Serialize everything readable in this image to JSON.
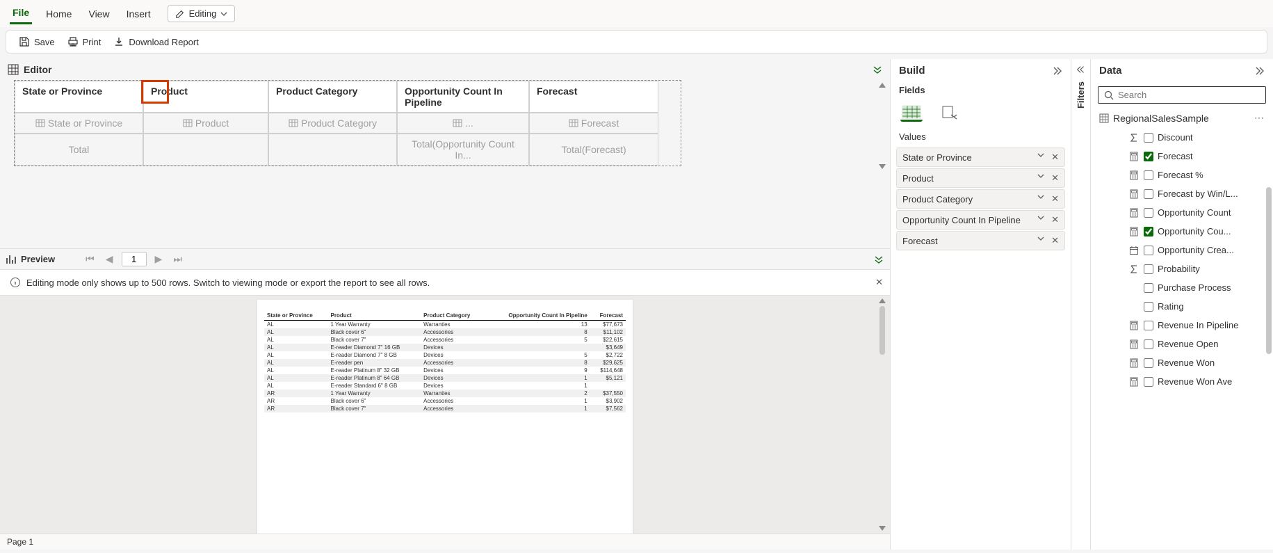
{
  "menu": {
    "file": "File",
    "home": "Home",
    "view": "View",
    "insert": "Insert",
    "editing": "Editing"
  },
  "toolbar": {
    "save": "Save",
    "print": "Print",
    "download": "Download Report"
  },
  "editor": {
    "title": "Editor",
    "headers": {
      "c1": "State or Province",
      "c2": "Product",
      "c3": "Product Category",
      "c4": "Opportunity Count In Pipeline",
      "c5": "Forecast"
    },
    "placeholders": {
      "c1": "State or Province",
      "c2": "Product",
      "c3": "Product Category",
      "c4": "...",
      "c5": "Forecast"
    },
    "totals": {
      "label": "Total",
      "c4": "Total(Opportunity Count In...",
      "c5": "Total(Forecast)"
    }
  },
  "preview": {
    "title": "Preview",
    "page": "1",
    "info": "Editing mode only shows up to 500 rows. Switch to viewing mode or export the report to see all rows.",
    "headers": [
      "State or Province",
      "Product",
      "Product Category",
      "Opportunity Count In Pipeline",
      "Forecast"
    ],
    "rows": [
      [
        "AL",
        "1 Year Warranty",
        "Warranties",
        "13",
        "$77,673"
      ],
      [
        "AL",
        "Black cover 6\"",
        "Accessories",
        "8",
        "$11,102"
      ],
      [
        "AL",
        "Black cover 7\"",
        "Accessories",
        "5",
        "$22,615"
      ],
      [
        "AL",
        "E-reader Diamond 7\" 16 GB",
        "Devices",
        "",
        "$3,649"
      ],
      [
        "AL",
        "E-reader Diamond 7\" 8 GB",
        "Devices",
        "5",
        "$2,722"
      ],
      [
        "AL",
        "E-reader pen",
        "Accessories",
        "8",
        "$29,625"
      ],
      [
        "AL",
        "E-reader Platinum 8\" 32 GB",
        "Devices",
        "9",
        "$114,648"
      ],
      [
        "AL",
        "E-reader Platinum 8\" 64 GB",
        "Devices",
        "1",
        "$5,121"
      ],
      [
        "AL",
        "E-reader Standard 6\" 8 GB",
        "Devices",
        "1",
        ""
      ],
      [
        "AR",
        "1 Year Warranty",
        "Warranties",
        "2",
        "$37,550"
      ],
      [
        "AR",
        "Black cover 6\"",
        "Accessories",
        "1",
        "$3,902"
      ],
      [
        "AR",
        "Black cover 7\"",
        "Accessories",
        "1",
        "$7,562"
      ]
    ]
  },
  "status": {
    "page": "Page 1"
  },
  "build": {
    "title": "Build",
    "fields": "Fields",
    "values": "Values",
    "pills": [
      "State or Province",
      "Product",
      "Product Category",
      "Opportunity Count In Pipeline",
      "Forecast"
    ]
  },
  "filters": {
    "label": "Filters"
  },
  "data": {
    "title": "Data",
    "search_ph": "Search",
    "dataset": "RegionalSalesSample",
    "fields": [
      {
        "icon": "sigma",
        "checked": false,
        "label": "Discount"
      },
      {
        "icon": "calc",
        "checked": true,
        "label": "Forecast"
      },
      {
        "icon": "calc",
        "checked": false,
        "label": "Forecast %"
      },
      {
        "icon": "calc",
        "checked": false,
        "label": "Forecast by Win/L..."
      },
      {
        "icon": "calc",
        "checked": false,
        "label": "Opportunity Count"
      },
      {
        "icon": "calc",
        "checked": true,
        "label": "Opportunity Cou..."
      },
      {
        "icon": "date",
        "checked": false,
        "label": "Opportunity Crea..."
      },
      {
        "icon": "sigma",
        "checked": false,
        "label": "Probability"
      },
      {
        "icon": "none",
        "checked": false,
        "label": "Purchase Process"
      },
      {
        "icon": "none",
        "checked": false,
        "label": "Rating"
      },
      {
        "icon": "calc",
        "checked": false,
        "label": "Revenue In Pipeline"
      },
      {
        "icon": "calc",
        "checked": false,
        "label": "Revenue Open"
      },
      {
        "icon": "calc",
        "checked": false,
        "label": "Revenue Won"
      },
      {
        "icon": "calc",
        "checked": false,
        "label": "Revenue Won Ave"
      }
    ]
  }
}
